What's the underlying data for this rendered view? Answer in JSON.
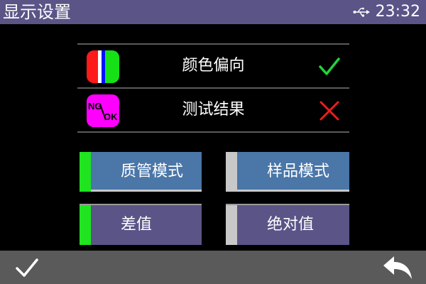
{
  "header": {
    "title": "显示设置",
    "time": "23:32",
    "usb_icon": "usb-icon"
  },
  "options": [
    {
      "label": "颜色偏向",
      "icon": "rgb-color-bars-icon",
      "state": "enabled",
      "state_icon": "check-icon",
      "state_color": "#23d13b"
    },
    {
      "label": "测试结果",
      "icon": "ng-ok-icon",
      "icon_text_ng": "NG",
      "icon_text_ok": "OK",
      "state": "disabled",
      "state_icon": "cross-icon",
      "state_color": "#e81f1f"
    }
  ],
  "modes": {
    "row1": {
      "left": {
        "label": "质管模式",
        "selected": true
      },
      "right": {
        "label": "样品模式",
        "selected": false
      }
    },
    "row2": {
      "left": {
        "label": "差值",
        "selected": true
      },
      "right": {
        "label": "绝对值",
        "selected": false
      }
    }
  },
  "footer": {
    "confirm_icon": "check-icon",
    "back_icon": "back-arrow-icon"
  },
  "colors": {
    "header_bg": "#5a5487",
    "footer_bg": "#5a5a5a",
    "mode_row1_bg": "#4a76a8",
    "mode_row2_bg": "#5a5487",
    "indicator_on": "#1fe41f",
    "indicator_off": "#c8c8c8",
    "ng_ok_bg": "#ff00ff"
  }
}
